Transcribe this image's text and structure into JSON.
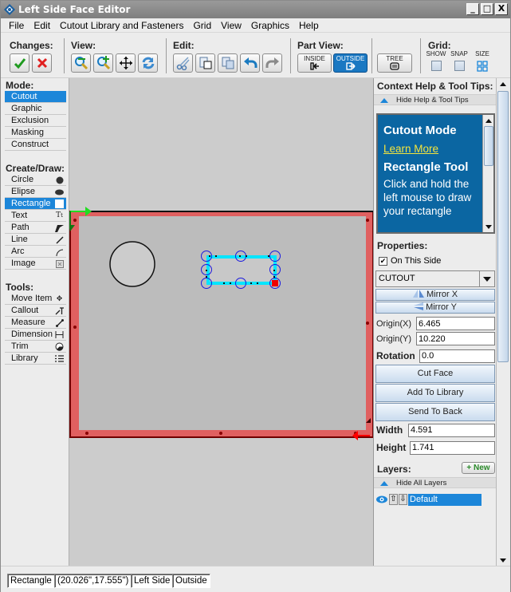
{
  "window": {
    "title": "Left Side Face Editor",
    "controls": [
      "minimize",
      "maximize",
      "close"
    ]
  },
  "menubar": {
    "items": [
      {
        "label": "File",
        "mnemonic": "F"
      },
      {
        "label": "Edit",
        "mnemonic": "E"
      },
      {
        "label": "Cutout Library and Fasteners",
        "mnemonic": "C"
      },
      {
        "label": "Grid",
        "mnemonic": "d"
      },
      {
        "label": "View",
        "mnemonic": "i"
      },
      {
        "label": "Graphics",
        "mnemonic": "G"
      },
      {
        "label": "Help",
        "mnemonic": "H"
      }
    ]
  },
  "toolbar": {
    "changes_label": "Changes:",
    "view_label": "View:",
    "edit_label": "Edit:",
    "part_view_label": "Part View:",
    "grid_label": "Grid:",
    "changes": [
      {
        "icon": "accept-check-icon"
      },
      {
        "icon": "cancel-x-icon"
      }
    ],
    "view": [
      {
        "icon": "zoom-out-icon"
      },
      {
        "icon": "zoom-in-icon"
      },
      {
        "icon": "pan-move-icon"
      },
      {
        "icon": "refresh-icon"
      }
    ],
    "edit": [
      {
        "icon": "cut-scissors-icon"
      },
      {
        "icon": "paste-icon"
      },
      {
        "icon": "copy-icon"
      },
      {
        "icon": "undo-icon"
      },
      {
        "icon": "redo-icon"
      }
    ],
    "part_view": [
      {
        "label": "INSIDE",
        "active": false
      },
      {
        "label": "OUTSIDE",
        "active": true
      }
    ],
    "tree_label": "TREE",
    "grid": [
      {
        "label": "SHOW"
      },
      {
        "label": "SNAP"
      },
      {
        "label": "SIZE"
      }
    ]
  },
  "left_panel": {
    "mode_title": "Mode:",
    "modes": [
      {
        "label": "Cutout",
        "selected": true
      },
      {
        "label": "Graphic",
        "selected": false
      },
      {
        "label": "Exclusion",
        "selected": false
      },
      {
        "label": "Masking",
        "selected": false
      },
      {
        "label": "Construct",
        "selected": false
      }
    ],
    "create_title": "Create/Draw:",
    "create": [
      {
        "label": "Circle",
        "icon": "circle-icon",
        "selected": false
      },
      {
        "label": "Elipse",
        "icon": "ellipse-icon",
        "selected": false
      },
      {
        "label": "Rectangle",
        "icon": "rectangle-icon",
        "selected": true
      },
      {
        "label": "Text",
        "icon": "text-icon",
        "selected": false
      },
      {
        "label": "Path",
        "icon": "path-icon",
        "selected": false
      },
      {
        "label": "Line",
        "icon": "line-icon",
        "selected": false
      },
      {
        "label": "Arc",
        "icon": "arc-icon",
        "selected": false
      },
      {
        "label": "Image",
        "icon": "image-icon",
        "selected": false
      }
    ],
    "tools_title": "Tools:",
    "tools": [
      {
        "label": "Move Item",
        "icon": "move-icon"
      },
      {
        "label": "Callout",
        "icon": "callout-icon"
      },
      {
        "label": "Measure",
        "icon": "measure-icon"
      },
      {
        "label": "Dimension",
        "icon": "dimension-icon"
      },
      {
        "label": "Trim",
        "icon": "trim-icon"
      },
      {
        "label": "Library",
        "icon": "library-icon"
      }
    ]
  },
  "right_panel": {
    "help_title": "Context Help & Tool Tips:",
    "hide_help": "Hide Help & Tool Tips",
    "help": {
      "mode_heading": "Cutout Mode",
      "learn_more": "Learn More",
      "tool_heading": "Rectangle Tool",
      "tool_text": "Click and hold the left mouse to draw your rectangle"
    },
    "properties_title": "Properties:",
    "on_this_side_label": "On This Side",
    "on_this_side_checked": true,
    "type_select": "CUTOUT",
    "mirror_x": "Mirror X",
    "mirror_y": "Mirror Y",
    "origin_x_label": "Origin(X)",
    "origin_x": "6.465",
    "origin_y_label": "Origin(Y)",
    "origin_y": "10.220",
    "rotation_label": "Rotation",
    "rotation": "0.0",
    "cut_face": "Cut Face",
    "add_to_library": "Add To Library",
    "send_to_back": "Send To Back",
    "width_label": "Width",
    "width": "4.591",
    "height_label": "Height",
    "height": "1.741",
    "layers_title": "Layers:",
    "new_layer": "+ New",
    "hide_layers": "Hide All Layers",
    "layers": [
      {
        "name": "Default",
        "visible": true,
        "selected": true
      }
    ]
  },
  "canvas": {
    "face_color": "#e06060",
    "panel_color": "#bcbcbc",
    "selection_color": "#00e5ff"
  },
  "statusbar": {
    "tool": "Rectangle",
    "coords": "(20.026\",17.555\")",
    "side": "Left Side",
    "view": "Outside"
  }
}
